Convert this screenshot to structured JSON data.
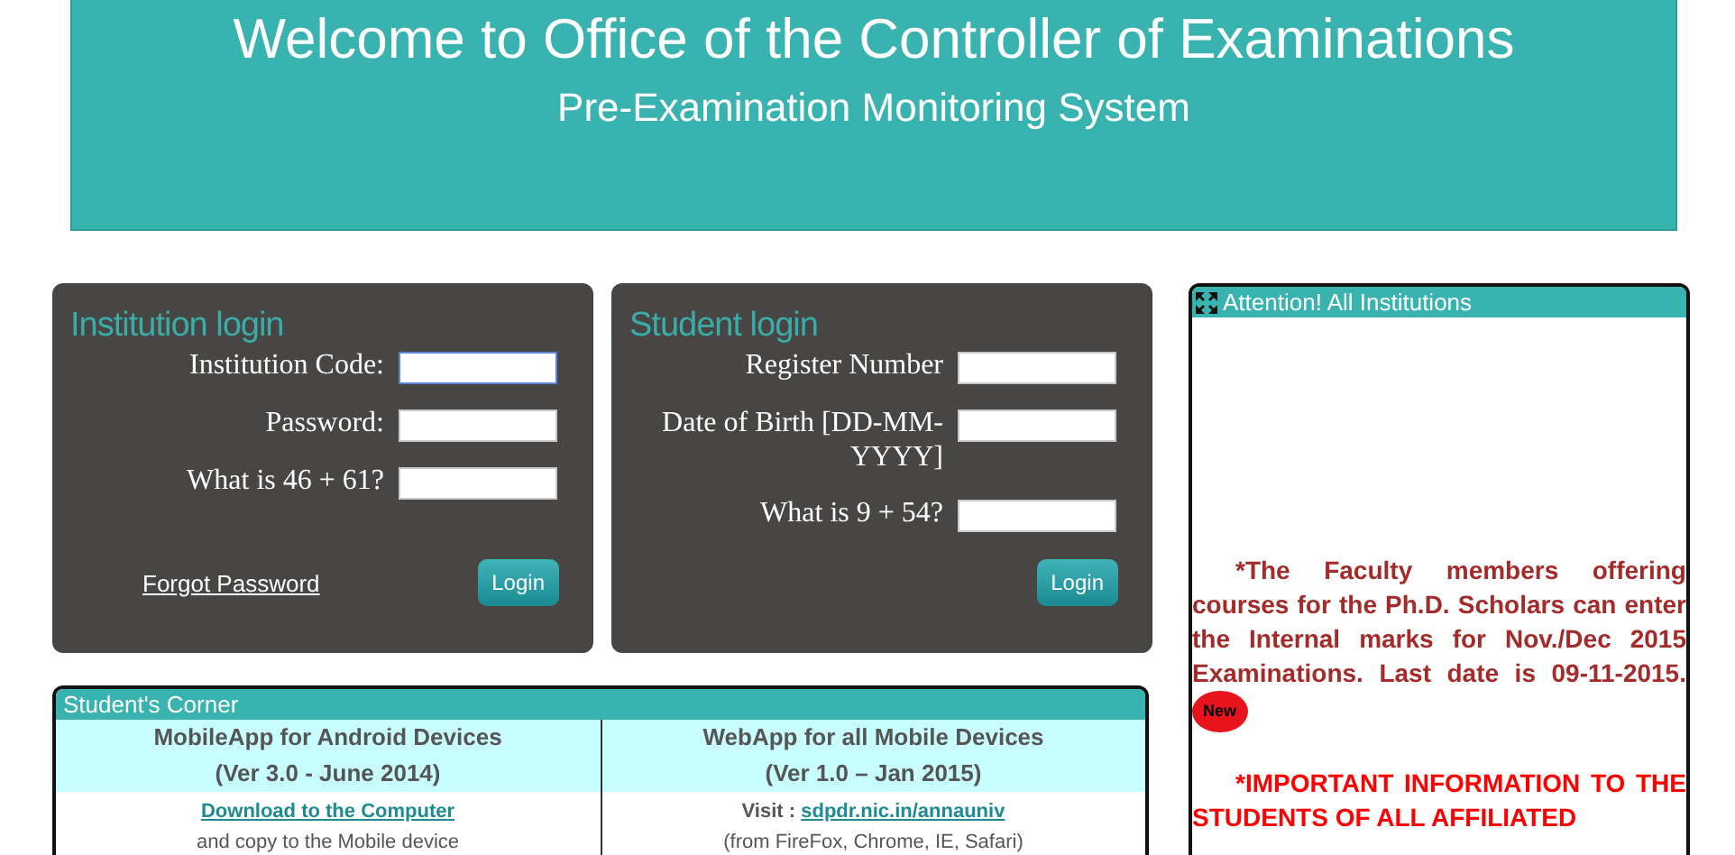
{
  "header": {
    "title": "Welcome to Office of the Controller of Examinations",
    "subtitle": "Pre-Examination Monitoring System"
  },
  "login_panels": [
    {
      "title": "Institution login",
      "fields": [
        {
          "label": "Institution Code:",
          "focused": true
        },
        {
          "label": "Password:",
          "focused": false
        },
        {
          "label": "What is 46 + 61?",
          "focused": false
        }
      ],
      "link": "Forgot Password",
      "button": "Login"
    },
    {
      "title": "Student login",
      "fields": [
        {
          "label": "Register Number",
          "focused": false
        },
        {
          "label": "Date of Birth [DD-MM-YYYY]",
          "focused": false
        },
        {
          "label": "What is 9 + 54?",
          "focused": false
        }
      ],
      "button": "Login"
    }
  ],
  "students_corner": {
    "title": "Student's Corner",
    "columns": [
      {
        "heading": "MobileApp for Android Devices",
        "version": "(Ver 3.0 - June 2014)",
        "link": "Download to the Computer",
        "note": "and copy to the Mobile device"
      },
      {
        "heading": "WebApp for all Mobile Devices",
        "version": "(Ver 1.0 – Jan 2015)",
        "prefix": "Visit :",
        "link": "sdpdr.nic.in/annauniv",
        "note": "(from FireFox, Chrome, IE, Safari)"
      }
    ]
  },
  "notice": {
    "title": "Attention! All Institutions",
    "items": [
      {
        "text": "*The Faculty members offering courses for the Ph.D. Scholars can enter the Internal marks for Nov./Dec 2015 Examinations. Last date is 09-11-2015.",
        "badge": "New",
        "color": "#a52a2a"
      },
      {
        "text": "*IMPORTANT INFORMATION TO THE STUDENTS OF ALL AFFILIATED",
        "color": "#ff0000"
      }
    ]
  }
}
